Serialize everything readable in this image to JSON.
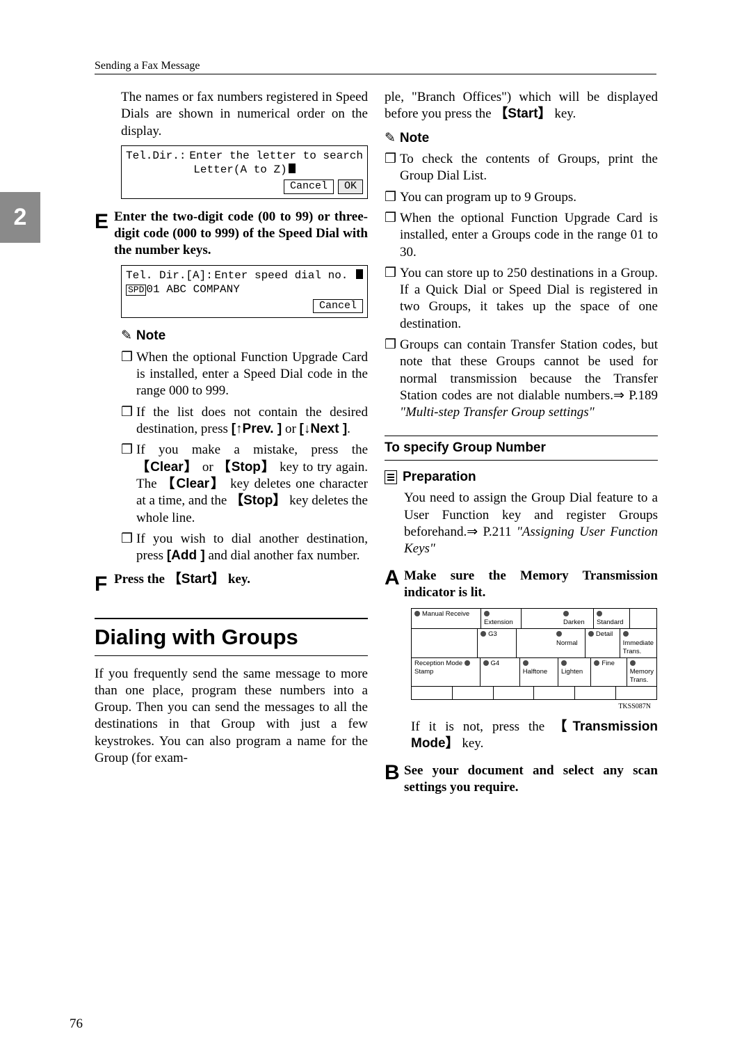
{
  "header": {
    "section": "Sending a Fax Message"
  },
  "pageTab": "2",
  "pageNumber": "76",
  "left": {
    "intro": "The names or fax numbers registered in Speed Dials are shown in numerical order on the display.",
    "lcd1": {
      "l1a": "Tel.Dir.:",
      "l1b": "Enter the letter to search",
      "l2": "Letter(A to Z)",
      "btnCancel": "Cancel",
      "btnOK": "OK"
    },
    "stepE_letter": "E",
    "stepE_text": "Enter the two-digit code (00 to 99) or three-digit code (000 to 999) of the Speed Dial with the number keys.",
    "lcd2": {
      "l1a": "Tel. Dir.[A]:",
      "l1b": "Enter speed dial no.",
      "l2tag": "SPD",
      "l2txt": "01 ABC COMPANY",
      "btnCancel": "Cancel"
    },
    "noteLabel": "Note",
    "note1": "When the optional Function Upgrade Card is installed, enter a Speed Dial code in the range 000 to 999.",
    "note2a": "If the list does not contain the desired destination, press ",
    "note2_prev": "[↑Prev. ]",
    "note2b": " or ",
    "note2_next": "[↓Next ]",
    "note2c": ".",
    "note3a": "If you make a mistake, press the ",
    "kClear": "Clear",
    "note3b": " or ",
    "kStop": "Stop",
    "note3c": " key to try again. The ",
    "note3d": " key deletes one character at a time, and the ",
    "note3e": " key deletes the whole line.",
    "note4a": "If you wish to dial another destination, press ",
    "kAdd": "[Add ]",
    "note4b": " and dial another fax number.",
    "stepF_letter": "F",
    "stepF_a": "Press the ",
    "kStart": "Start",
    "stepF_b": " key.",
    "h2": "Dialing with Groups",
    "groupsPara": "If you frequently send the same message to more than one place, program these numbers into a Group. Then you can send the messages to all the destinations in that Group with just a few keystrokes. You can also program a name for the Group (for exam-"
  },
  "right": {
    "cont": "ple, \"Branch Offices\") which will be displayed before you press the ",
    "kStart": "Start",
    "contB": " key.",
    "noteLabel": "Note",
    "n1": "To check the contents of Groups, print the Group Dial List.",
    "n2": "You can program up to 9 Groups.",
    "n3": "When the optional Function Upgrade Card is installed, enter a Groups code in the range 01 to 30.",
    "n4": "You can store up to 250 destinations in a Group. If a Quick Dial or Speed Dial is registered in two Groups, it takes up the space of one destination.",
    "n5a": "Groups can contain Transfer Station codes, but note that these Groups cannot be used for normal transmission because the Transfer Station codes are not dialable numbers.⇒ P.189 ",
    "n5i": "\"Multi-step Transfer Group settings\"",
    "h3": "To specify Group Number",
    "prepLabel": "Preparation",
    "prepText": "You need to assign the Group Dial feature to a User Function key and register Groups beforehand.⇒ P.211 ",
    "prepItalic": "\"Assigning User Function Keys\"",
    "stepA_letter": "A",
    "stepA_text": "Make sure the Memory Transmission indicator is lit.",
    "panel": {
      "manualRecv": "Manual Receive",
      "recMode": "Reception Mode",
      "stamp": "Stamp",
      "ext": "Extension",
      "g3": "G3",
      "g4": "G4",
      "halftone": "Halftone",
      "darken": "Darken",
      "normal": "Normal",
      "lighten": "Lighten",
      "standard": "Standard",
      "detail": "Detail",
      "fine": "Fine",
      "imm": "Immediate Trans.",
      "mem": "Memory Trans.",
      "id": "TKSS087N"
    },
    "afterPanelA": "If it is not, press the ",
    "kTransMode": "Transmission Mode",
    "afterPanelB": " key.",
    "stepB_letter": "B",
    "stepB_text": "See your document and select any scan settings you require."
  }
}
